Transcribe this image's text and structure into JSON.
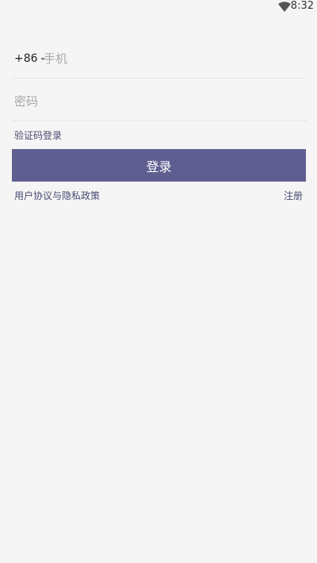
{
  "status_bar": {
    "time": "8:32",
    "wifi_icon": "wifi-icon"
  },
  "login_form": {
    "country_code": "+86",
    "phone_placeholder": "手机",
    "phone_value": "",
    "password_placeholder": "密码",
    "password_value": "",
    "code_login_label": "验证码登录",
    "login_button_label": "登录",
    "agreement_label": "用户协议与隐私政策",
    "register_label": "注册"
  },
  "colors": {
    "background": "#f5f5f5",
    "primary_button": "#5f5e90",
    "link_text": "#4a4a73",
    "placeholder": "#a8a8a8",
    "divider": "#e6e6e6"
  }
}
